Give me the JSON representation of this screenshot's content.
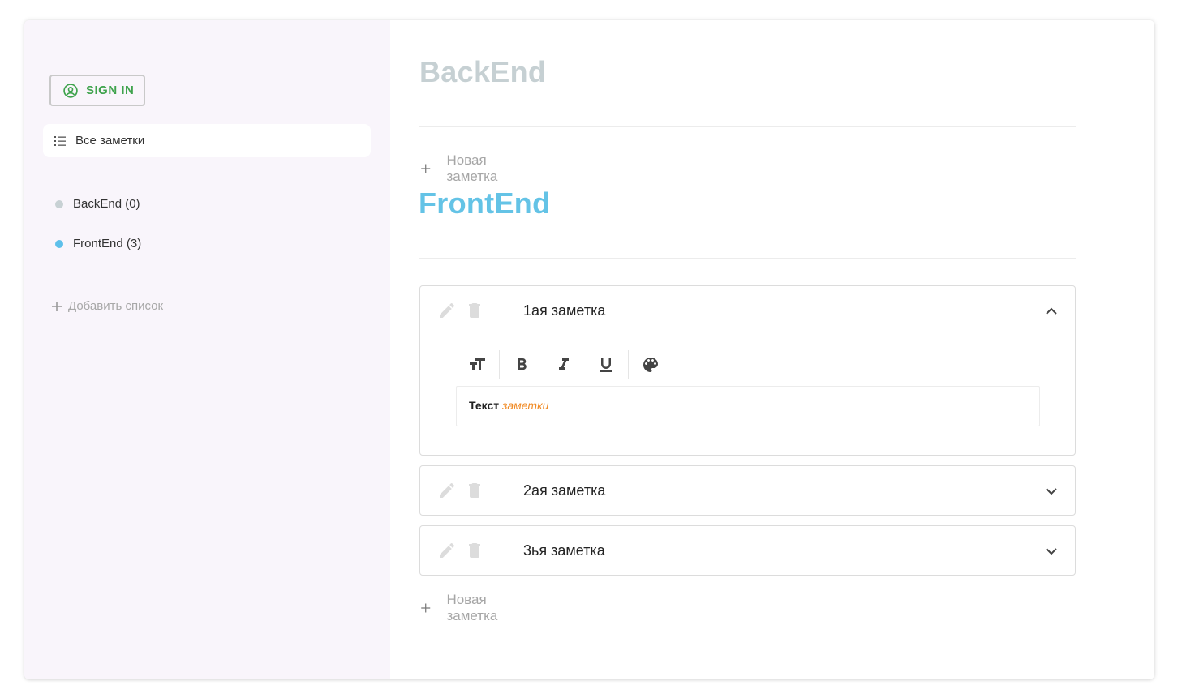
{
  "sidebar": {
    "sign_in_label": "SIGN IN",
    "all_notes_label": "Все заметки",
    "lists": [
      {
        "label": "BackEnd (0)",
        "color": "#c8d1d4"
      },
      {
        "label": "FrontEnd (3)",
        "color": "#5ec0ea"
      }
    ],
    "add_list_label": "Добавить список"
  },
  "sections": {
    "backend": {
      "title": "BackEnd",
      "color": "#c6d0d3",
      "new_note_label": "Новая заметка"
    },
    "frontend": {
      "title": "FrontEnd",
      "color": "#64c3e6",
      "new_note_label": "Новая заметка",
      "notes": [
        {
          "title": "1ая заметка",
          "expanded": true,
          "body_bold": "Текст",
          "body_italic": "заметки"
        },
        {
          "title": "2ая заметка",
          "expanded": false
        },
        {
          "title": "3ья заметка",
          "expanded": false
        }
      ]
    }
  },
  "toolbar_icons": [
    "text-size-icon",
    "bold-icon",
    "italic-icon",
    "underline-icon",
    "palette-icon"
  ],
  "colors": {
    "accent_green": "#3fa34d",
    "sidebar_bg": "#f9f5fb",
    "editor_italic": "#f08a24"
  }
}
